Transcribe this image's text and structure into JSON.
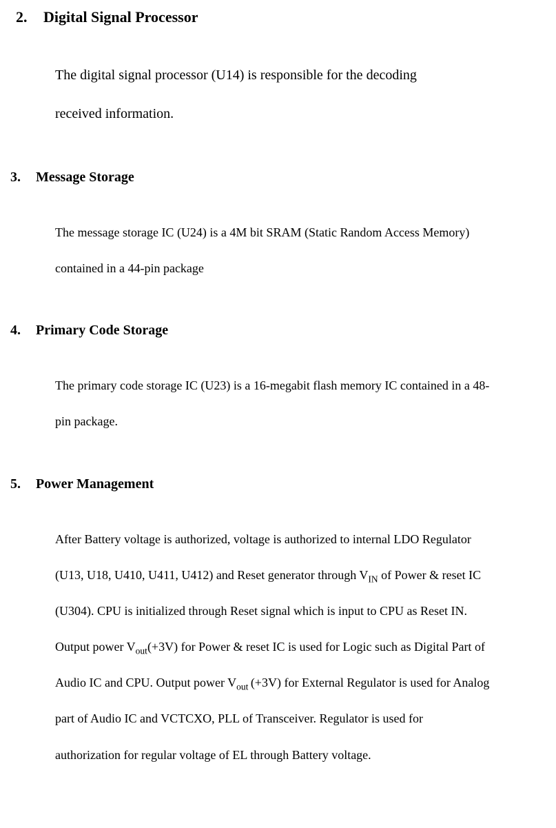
{
  "sec2": {
    "num": "2.",
    "title": "Digital Signal Processor",
    "body_l1": "The digital signal processor (U14) is responsible for the decoding",
    "body_l2": "received information."
  },
  "sec3": {
    "num": "3.",
    "title": "Message Storage",
    "body_l1": "The message storage IC (U24) is a 4M bit SRAM (Static Random Access Memory)",
    "body_l2": "contained in a 44-pin package"
  },
  "sec4": {
    "num": "4.",
    "title": "Primary Code Storage",
    "body_l1_a": "The primary code storage IC (U23) is a",
    "body_l1_b": "16-megabit flash memory IC contained in a 48-",
    "body_l2": "pin package."
  },
  "sec5": {
    "num": "5.",
    "title": "Power Management",
    "l1": "After Battery voltage is authorized, voltage is authorized to internal LDO Regulator",
    "l2a": "(U13, U18, U410, U411, U412) and Reset generator through V",
    "l2sub": "IN",
    "l2b": "    of Power & reset IC",
    "l3": "(U304). CPU is initialized through Reset signal which is input to CPU as Reset IN.",
    "l4a": "Output power V",
    "l4sub": "out",
    "l4b": "(+3V) for Power & reset IC is used for Logic such as Digital Part of",
    "l5a": "Audio IC and CPU. Output power V",
    "l5sub": "out ",
    "l5b": "(+3V) for External Regulator is used for Analog",
    "l6": "part of Audio IC and VCTCXO, PLL of Transceiver. Regulator is used for",
    "l7": "authorization for regular voltage of EL through Battery voltage."
  }
}
